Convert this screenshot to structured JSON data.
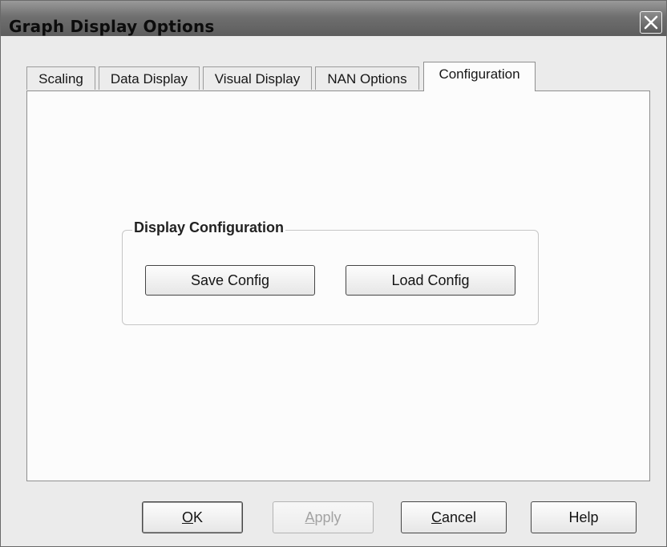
{
  "window": {
    "title": "Graph Display Options"
  },
  "tabs": [
    {
      "label": "Scaling",
      "active": false
    },
    {
      "label": "Data Display",
      "active": false
    },
    {
      "label": "Visual Display",
      "active": false
    },
    {
      "label": "NAN Options",
      "active": false
    },
    {
      "label": "Configuration",
      "active": true
    }
  ],
  "group": {
    "legend": "Display Configuration",
    "save_label": "Save Config",
    "load_label": "Load Config"
  },
  "footer": {
    "ok_mnemonic": "O",
    "ok_rest": "K",
    "apply_mnemonic": "A",
    "apply_rest": "pply",
    "cancel_mnemonic": "C",
    "cancel_rest": "ancel",
    "help_label": "Help"
  },
  "icons": {
    "close": "close-icon"
  },
  "colors": {
    "titlebar": "#6f6f6f",
    "panel": "#fcfcfc",
    "dialog": "#ebebeb"
  }
}
